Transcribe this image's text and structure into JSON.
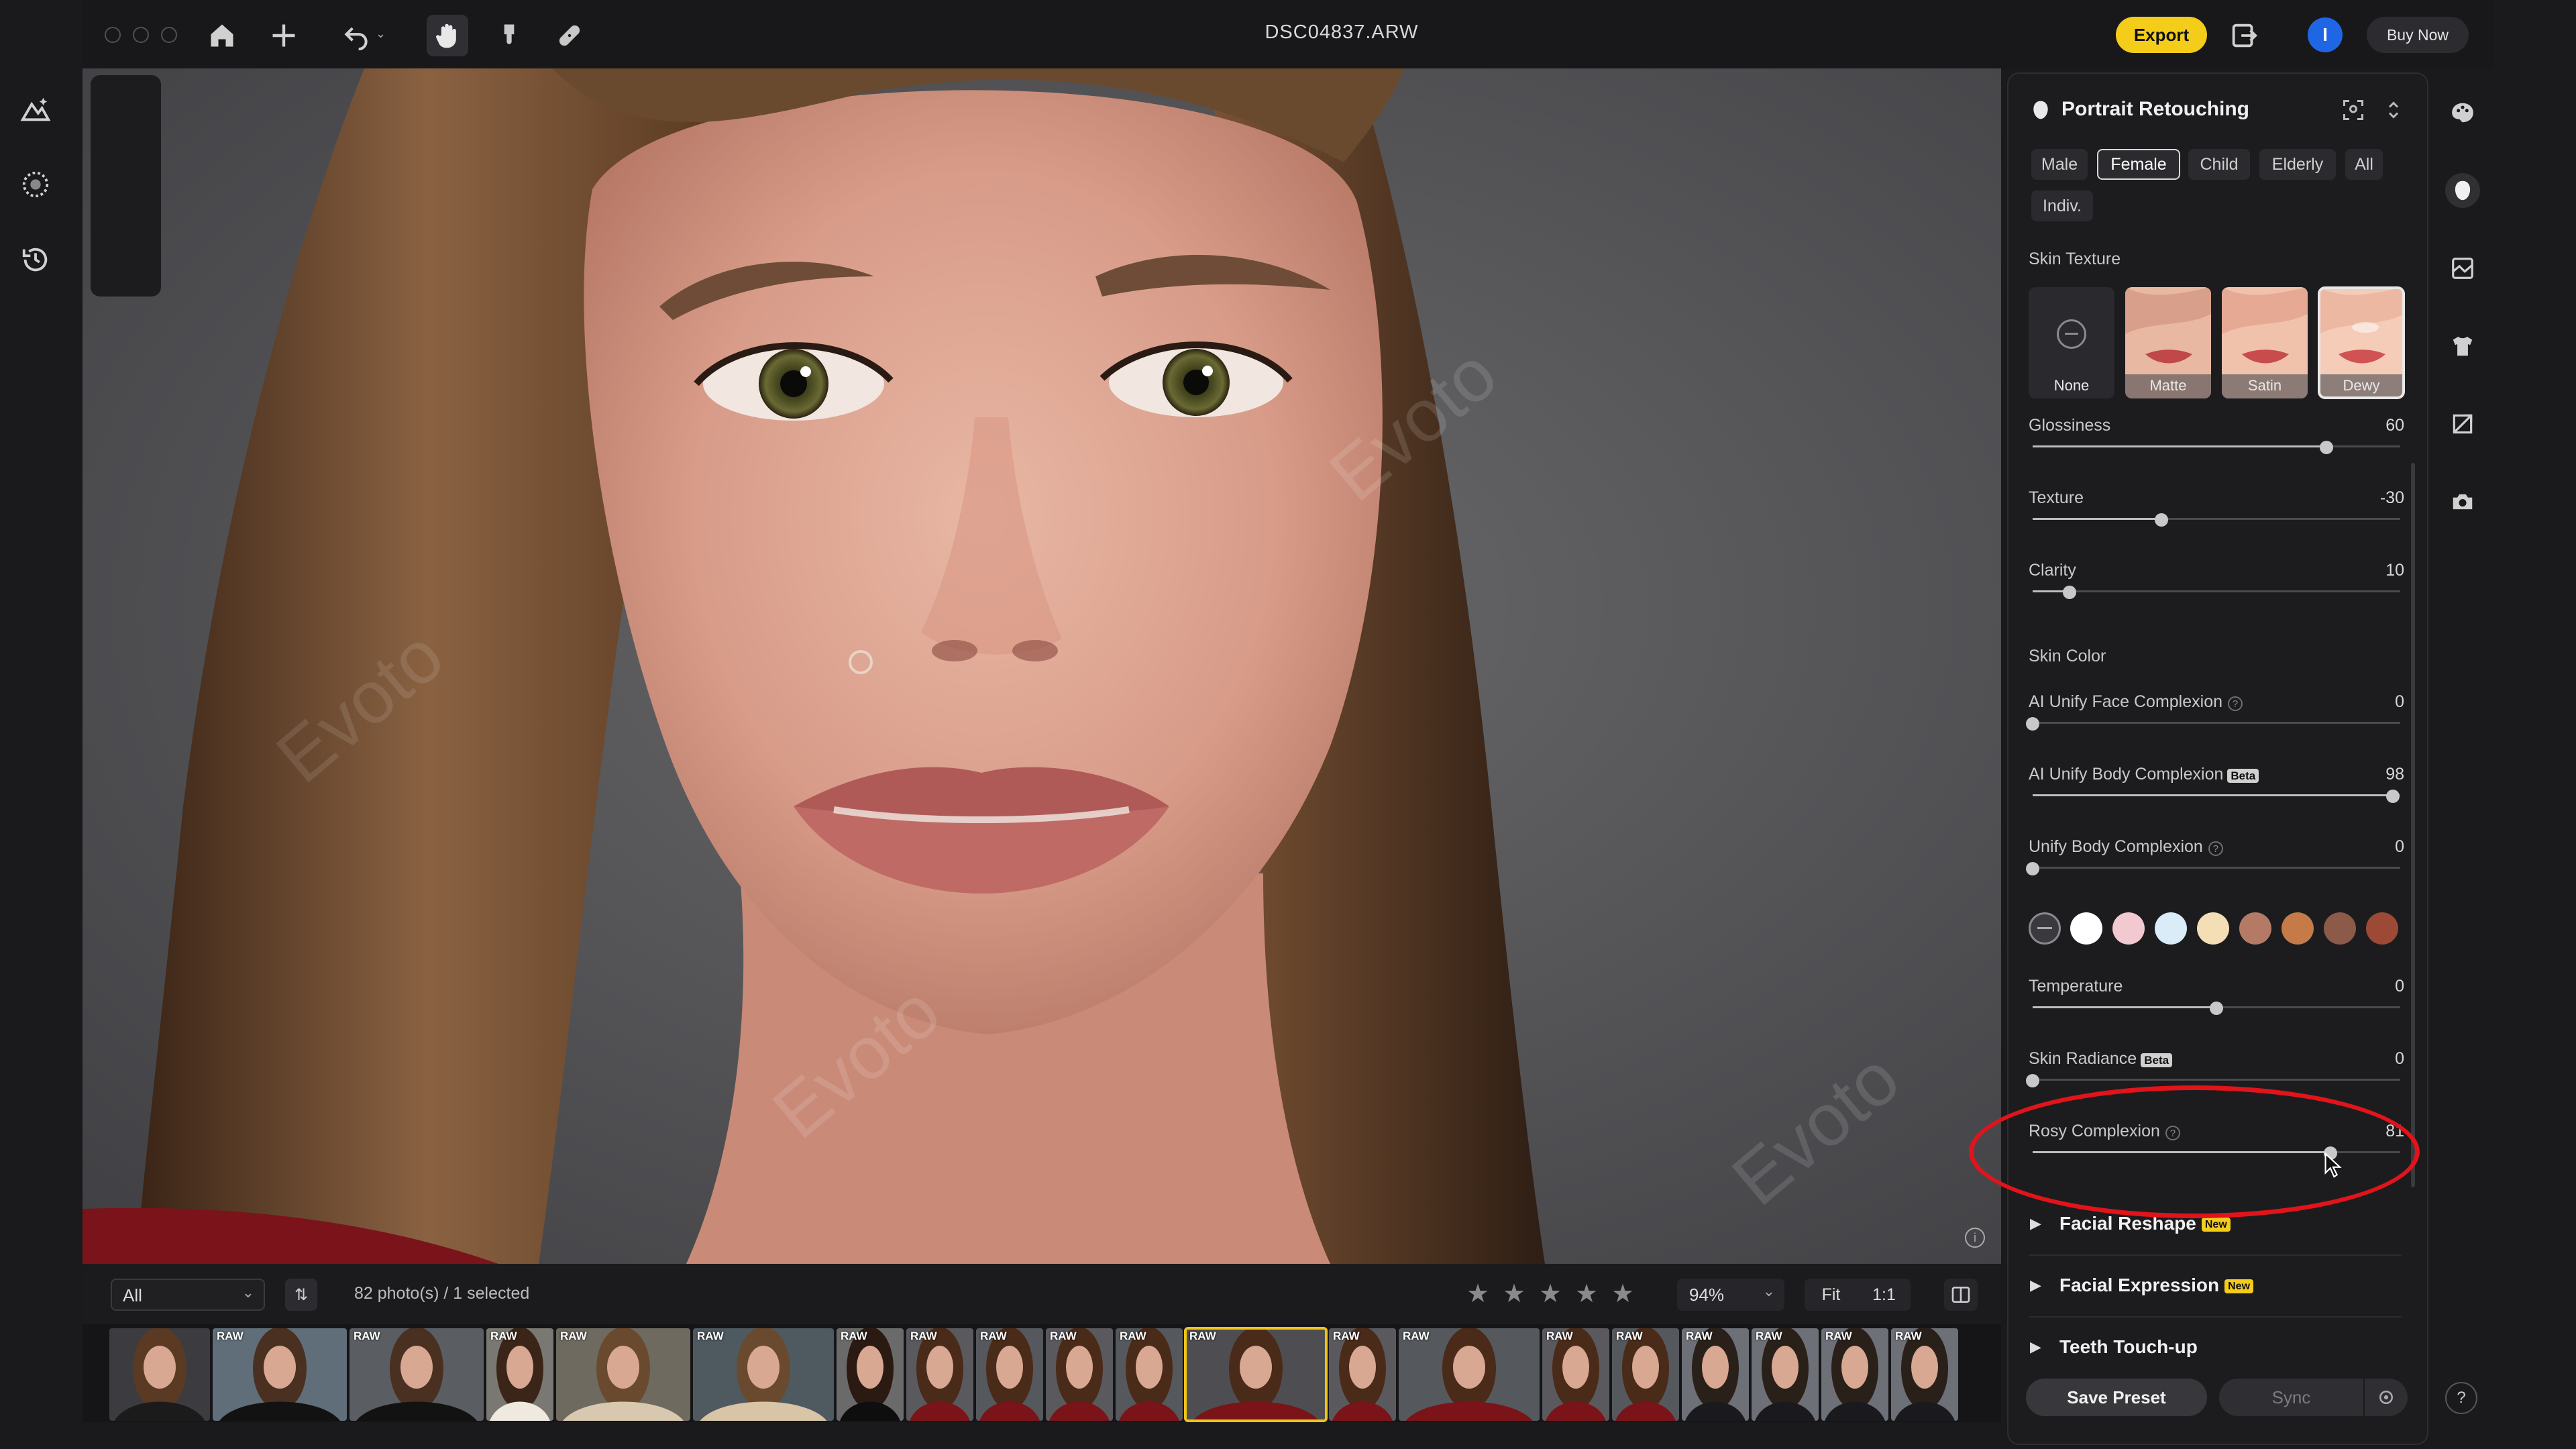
{
  "window": {
    "title": "DSC04837.ARW"
  },
  "toolbar": {
    "export_label": "Export",
    "buy_label": "Buy Now",
    "user_initial": "I",
    "icons": [
      "home-icon",
      "add-icon",
      "undo-icon",
      "hand-icon",
      "brush-icon",
      "bandage-icon"
    ]
  },
  "photo": {
    "watermark": "Evoto"
  },
  "filmstrip_bar": {
    "filter": "All",
    "count_text": "82 photo(s) / 1 selected",
    "zoom": "94%",
    "fit_label": "Fit",
    "one_to_one_label": "1:1",
    "stars": [
      "★",
      "★",
      "★",
      "★",
      "★"
    ]
  },
  "filmstrip": {
    "raw_label": "RAW",
    "thumbnails": [
      {
        "raw": false,
        "bg": "#3c3c40",
        "hair": "#5a3a22",
        "cloth": "#1b1b1b",
        "selected": false
      },
      {
        "raw": true,
        "bg": "#5f6e78",
        "hair": "#4a3020",
        "cloth": "#121212",
        "selected": false
      },
      {
        "raw": true,
        "bg": "#5a5e62",
        "hair": "#4a3020",
        "cloth": "#121212",
        "selected": false
      },
      {
        "raw": true,
        "bg": "#7a7872",
        "hair": "#3a2518",
        "cloth": "#efe9e0",
        "selected": false
      },
      {
        "raw": true,
        "bg": "#6e6a60",
        "hair": "#6a4a2e",
        "cloth": "#d9c8b0",
        "selected": false
      },
      {
        "raw": true,
        "bg": "#4e5a60",
        "hair": "#6a4a2e",
        "cloth": "#d8c4a6",
        "selected": false
      },
      {
        "raw": true,
        "bg": "#6a6a6a",
        "hair": "#2a1a12",
        "cloth": "#0e0e0e",
        "selected": false
      },
      {
        "raw": true,
        "bg": "#5a5a5e",
        "hair": "#4a2a18",
        "cloth": "#7a1418",
        "selected": false
      },
      {
        "raw": true,
        "bg": "#55585c",
        "hair": "#4a2a18",
        "cloth": "#7a1418",
        "selected": false
      },
      {
        "raw": true,
        "bg": "#5a5a5e",
        "hair": "#4a2a18",
        "cloth": "#7a1418",
        "selected": false
      },
      {
        "raw": true,
        "bg": "#55585c",
        "hair": "#4a2a18",
        "cloth": "#7a1418",
        "selected": false
      },
      {
        "raw": true,
        "bg": "#4e4e52",
        "hair": "#4a2a18",
        "cloth": "#7a1418",
        "selected": true
      },
      {
        "raw": true,
        "bg": "#5a5a5e",
        "hair": "#4a2a18",
        "cloth": "#7a1418",
        "selected": false
      },
      {
        "raw": true,
        "bg": "#55585c",
        "hair": "#4a2a18",
        "cloth": "#7a1418",
        "selected": false
      },
      {
        "raw": true,
        "bg": "#5a5a5e",
        "hair": "#4a2a18",
        "cloth": "#7a1418",
        "selected": false
      },
      {
        "raw": true,
        "bg": "#55585c",
        "hair": "#4a2a18",
        "cloth": "#7a1418",
        "selected": false
      },
      {
        "raw": true,
        "bg": "#6e7078",
        "hair": "#2a201a",
        "cloth": "#1a1a1e",
        "selected": false
      },
      {
        "raw": true,
        "bg": "#6e7078",
        "hair": "#2a201a",
        "cloth": "#1a1a1e",
        "selected": false
      },
      {
        "raw": true,
        "bg": "#6e7078",
        "hair": "#2a201a",
        "cloth": "#1a1a1e",
        "selected": false
      },
      {
        "raw": true,
        "bg": "#6e7078",
        "hair": "#2a201a",
        "cloth": "#1a1a1e",
        "selected": false
      },
      {
        "raw": true,
        "bg": "#6e7078",
        "hair": "#2a201a",
        "cloth": "#1a1a1e",
        "selected": false
      }
    ]
  },
  "panel": {
    "title": "Portrait Retouching",
    "groups": [
      "Male",
      "Female",
      "Child",
      "Elderly",
      "All",
      "Indiv."
    ],
    "active_group": "Female",
    "skin_texture": {
      "title": "Skin Texture",
      "options": [
        "None",
        "Matte",
        "Satin",
        "Dewy"
      ],
      "active": "Dewy"
    },
    "sliders_texture": [
      {
        "label": "Glossiness",
        "value": "60",
        "pos": 0.8
      },
      {
        "label": "Texture",
        "value": "-30",
        "pos": 0.35
      },
      {
        "label": "Clarity",
        "value": "10",
        "pos": 0.1
      }
    ],
    "skin_color": {
      "title": "Skin Color",
      "sliders": [
        {
          "label": "AI Unify Face Complexion",
          "value": "0",
          "pos": 0.0,
          "help": true,
          "beta": false
        },
        {
          "label": "AI Unify Body Complexion",
          "value": "98",
          "pos": 0.98,
          "help": false,
          "beta": true
        },
        {
          "label": "Unify Body Complexion",
          "value": "0",
          "pos": 0.0,
          "help": true,
          "beta": false
        }
      ],
      "swatches": [
        "#ffffff",
        "#f2c9d0",
        "#d9ecf7",
        "#f3deb5",
        "#b57a66",
        "#c57a48",
        "#8c5a48",
        "#9c4a36"
      ],
      "sliders2": [
        {
          "label": "Temperature",
          "value": "0",
          "pos": 0.5,
          "help": false,
          "beta": false
        },
        {
          "label": "Skin Radiance",
          "value": "0",
          "pos": 0.0,
          "help": false,
          "beta": true
        },
        {
          "label": "Rosy Complexion",
          "value": "81",
          "pos": 0.81,
          "help": true,
          "beta": false
        }
      ],
      "beta_label": "Beta"
    },
    "sections": [
      {
        "label": "Facial Reshape",
        "badge": "New"
      },
      {
        "label": "Facial Expression",
        "badge": "New"
      },
      {
        "label": "Teeth Touch-up",
        "badge": ""
      }
    ],
    "save_preset_label": "Save Preset",
    "sync_label": "Sync"
  },
  "right_toolbar": {
    "icons": [
      "palette-icon",
      "face-retouch-icon",
      "background-icon",
      "clothing-icon",
      "crop-icon",
      "camera-icon"
    ],
    "help_label": "?"
  }
}
